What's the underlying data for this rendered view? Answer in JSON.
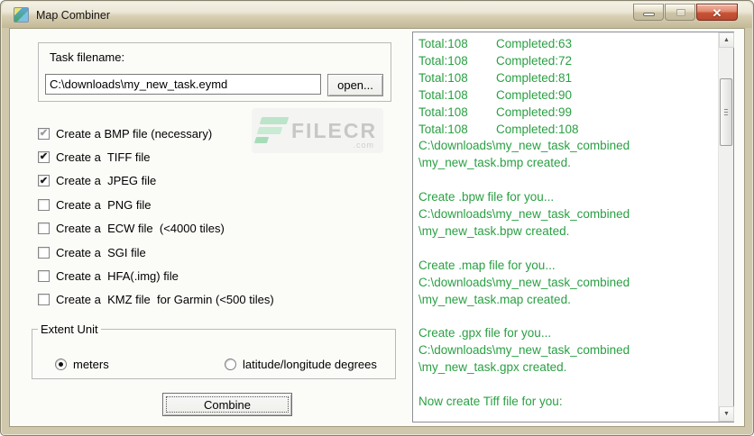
{
  "window": {
    "title": "Map Combiner"
  },
  "icons": {
    "app-icon": "map-thumbnail",
    "minimize-icon": "thin-bar",
    "maximize-icon": "square (disabled)",
    "close-icon": "✕",
    "check-icon": "✔",
    "scroll-up-icon": "▲",
    "scroll-down-icon": "▼",
    "watermark-logo-icon": "three-green-bars-flag"
  },
  "task": {
    "label": "Task filename:",
    "filename": "C:\\downloads\\my_new_task.eymd",
    "open_button": "open..."
  },
  "checkboxes": [
    {
      "label": "Create a BMP file (necessary)",
      "checked": true,
      "disabled": true
    },
    {
      "label": "Create a  TIFF file",
      "checked": true,
      "disabled": false
    },
    {
      "label": "Create a  JPEG file",
      "checked": true,
      "disabled": false
    },
    {
      "label": "Create a  PNG file",
      "checked": false,
      "disabled": false
    },
    {
      "label": "Create a  ECW file  (<4000 tiles)",
      "checked": false,
      "disabled": false
    },
    {
      "label": "Create a  SGI file",
      "checked": false,
      "disabled": false
    },
    {
      "label": "Create a  HFA(.img) file",
      "checked": false,
      "disabled": false
    },
    {
      "label": "Create a  KMZ file  for Garmin (<500 tiles)",
      "checked": false,
      "disabled": false
    }
  ],
  "extent_unit": {
    "label": "Extent Unit",
    "options": [
      {
        "label": "meters",
        "selected": true
      },
      {
        "label": "latitude/longitude degrees",
        "selected": false
      }
    ]
  },
  "combine_button": "Combine",
  "log": {
    "lines": [
      "Total:108\tCompleted:63",
      "Total:108\tCompleted:72",
      "Total:108\tCompleted:81",
      "Total:108\tCompleted:90",
      "Total:108\tCompleted:99",
      "Total:108\tCompleted:108",
      "C:\\downloads\\my_new_task_combined",
      "\\my_new_task.bmp created.",
      "",
      "Create .bpw file for you...",
      "C:\\downloads\\my_new_task_combined",
      "\\my_new_task.bpw created.",
      "",
      "Create .map file for you...",
      "C:\\downloads\\my_new_task_combined",
      "\\my_new_task.map created.",
      "",
      "Create .gpx file for you...",
      "C:\\downloads\\my_new_task_combined",
      "\\my_new_task.gpx created.",
      "",
      "Now create Tiff file for you:"
    ]
  },
  "watermark": {
    "text": "FILECR",
    "suffix": ".com"
  },
  "colors": {
    "log_text": "#2AA043",
    "frame_tan": "#CFC8AC",
    "close_red": "#C95235",
    "client_bg": "#FBFBF8"
  }
}
